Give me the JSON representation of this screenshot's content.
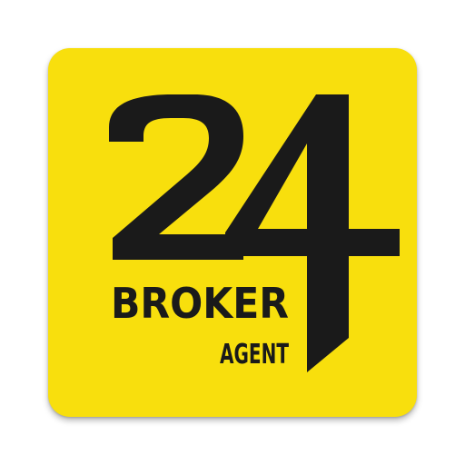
{
  "app_icon": {
    "brand_number": "24",
    "brand_word": "BROKER",
    "sub_word": "AGENT",
    "colors": {
      "tile_background": "#f8df0d",
      "logo_ink": "#1a1a1a",
      "page_background": "#ffffff"
    }
  }
}
